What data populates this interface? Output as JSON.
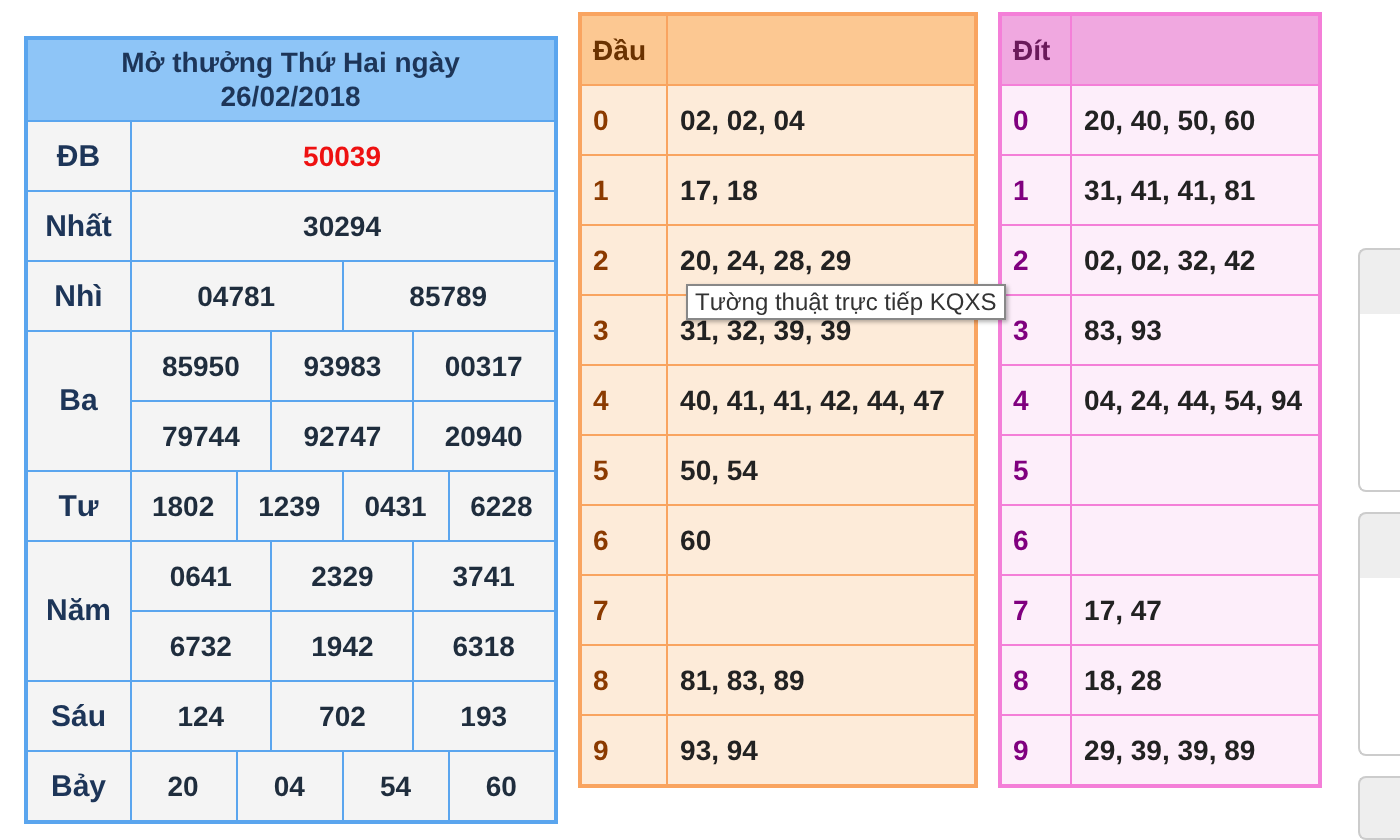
{
  "results": {
    "title": "Mở thưởng Thứ Hai ngày",
    "date": "26/02/2018",
    "prizes": [
      {
        "name": "ĐB",
        "kind": "special",
        "rows": [
          [
            "50039"
          ]
        ]
      },
      {
        "name": "Nhất",
        "kind": "normal",
        "rows": [
          [
            "30294"
          ]
        ]
      },
      {
        "name": "Nhì",
        "kind": "normal",
        "rows": [
          [
            "04781",
            "85789"
          ]
        ]
      },
      {
        "name": "Ba",
        "kind": "normal",
        "rows": [
          [
            "85950",
            "93983",
            "00317"
          ],
          [
            "79744",
            "92747",
            "20940"
          ]
        ]
      },
      {
        "name": "Tư",
        "kind": "normal",
        "rows": [
          [
            "1802",
            "1239",
            "0431",
            "6228"
          ]
        ]
      },
      {
        "name": "Năm",
        "kind": "normal",
        "rows": [
          [
            "0641",
            "2329",
            "3741"
          ],
          [
            "6732",
            "1942",
            "6318"
          ]
        ]
      },
      {
        "name": "Sáu",
        "kind": "normal",
        "rows": [
          [
            "124",
            "702",
            "193"
          ]
        ]
      },
      {
        "name": "Bảy",
        "kind": "normal",
        "rows": [
          [
            "20",
            "04",
            "54",
            "60"
          ]
        ]
      }
    ]
  },
  "dau": {
    "header": "Đầu",
    "rows": [
      {
        "digit": "0",
        "values": "02, 02, 04"
      },
      {
        "digit": "1",
        "values": "17, 18"
      },
      {
        "digit": "2",
        "values": "20, 24, 28, 29"
      },
      {
        "digit": "3",
        "values": "31, 32, 39, 39"
      },
      {
        "digit": "4",
        "values": "40, 41, 41, 42, 44, 47"
      },
      {
        "digit": "5",
        "values": "50, 54"
      },
      {
        "digit": "6",
        "values": "60"
      },
      {
        "digit": "7",
        "values": ""
      },
      {
        "digit": "8",
        "values": "81, 83, 89"
      },
      {
        "digit": "9",
        "values": "93, 94"
      }
    ]
  },
  "dit": {
    "header": "Đít",
    "rows": [
      {
        "digit": "0",
        "values": "20, 40, 50, 60"
      },
      {
        "digit": "1",
        "values": "31, 41, 41, 81"
      },
      {
        "digit": "2",
        "values": "02, 02, 32, 42"
      },
      {
        "digit": "3",
        "values": "83, 93"
      },
      {
        "digit": "4",
        "values": "04, 24, 44, 54, 94"
      },
      {
        "digit": "5",
        "values": ""
      },
      {
        "digit": "6",
        "values": ""
      },
      {
        "digit": "7",
        "values": "17, 47"
      },
      {
        "digit": "8",
        "values": "18, 28"
      },
      {
        "digit": "9",
        "values": "29, 39, 39, 89"
      }
    ]
  },
  "tooltip": "Tường thuật trực tiếp KQXS"
}
